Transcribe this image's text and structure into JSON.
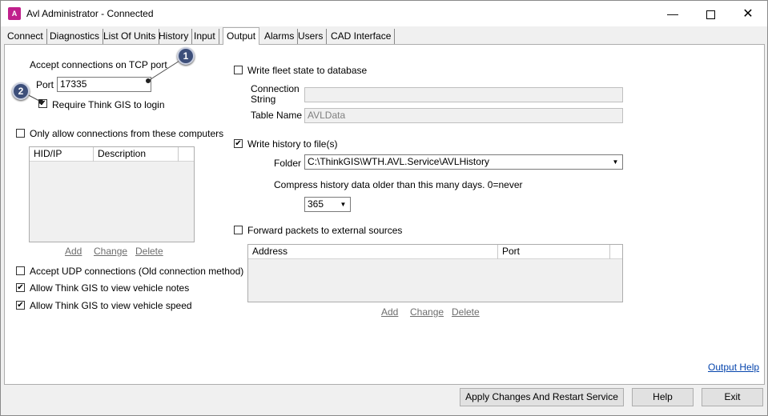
{
  "window": {
    "title": "Avl Administrator - Connected",
    "icon_name": "app-icon",
    "icon_glyph": "A"
  },
  "tabs": [
    {
      "label": "Connect"
    },
    {
      "label": "Diagnostics"
    },
    {
      "label": "List Of Units"
    },
    {
      "label": "History"
    },
    {
      "label": "Input"
    },
    {
      "label": "Output",
      "active": true
    },
    {
      "label": "Alarms"
    },
    {
      "label": "Users"
    },
    {
      "label": "CAD Interface"
    }
  ],
  "tcp": {
    "heading": "Accept connections on TCP port",
    "port_label": "Port",
    "port_value": "17335",
    "require_login_label": "Require Think GIS to login",
    "require_login_checked": true
  },
  "allowed_computers": {
    "label": "Only allow connections from these computers",
    "checked": false,
    "columns": [
      "HID/IP",
      "Description"
    ],
    "rows": [],
    "add_label": "Add",
    "change_label": "Change",
    "delete_label": "Delete"
  },
  "options": {
    "udp_label": "Accept UDP connections (Old connection method)",
    "udp_checked": false,
    "notes_label": "Allow Think GIS to view vehicle notes",
    "notes_checked": true,
    "speed_label": "Allow Think GIS to view vehicle speed",
    "speed_checked": true
  },
  "database": {
    "label": "Write fleet state to database",
    "checked": false,
    "connection_label_1": "Connection",
    "connection_label_2": "String",
    "connection_value": "",
    "table_label": "Table Name",
    "table_value": "AVLData"
  },
  "history": {
    "label": "Write history to file(s)",
    "checked": true,
    "folder_label": "Folder",
    "folder_value": "C:\\ThinkGIS\\WTH.AVL.Service\\AVLHistory",
    "compress_label": "Compress history data older than this many days.  0=never",
    "compress_value": "365"
  },
  "forward": {
    "label": "Forward packets to external sources",
    "checked": false,
    "columns": [
      "Address",
      "Port"
    ],
    "rows": [],
    "add_label": "Add",
    "change_label": "Change",
    "delete_label": "Delete"
  },
  "help_link": "Output Help",
  "buttons": {
    "apply": "Apply Changes And Restart Service",
    "help": "Help",
    "exit": "Exit"
  },
  "callouts": [
    "1",
    "2"
  ],
  "colors": {
    "accent_link": "#0645ad",
    "app_icon": "#c0208c",
    "callout_badge": "#3d4f7a"
  }
}
